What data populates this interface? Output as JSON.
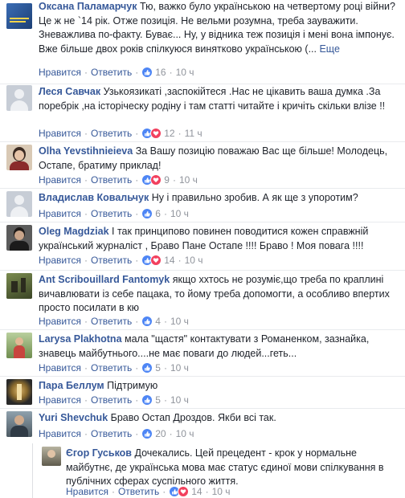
{
  "actions": {
    "like": "Нравится",
    "reply": "Ответить"
  },
  "comments": [
    {
      "name": "Оксана Паламарчук",
      "text": "Тю, важко було українською на четвертому році війни? Це ж не `14 рік. Отже позиція. Не вельми розумна, треба зауважити. Зневажлива по-факту. Буває... Ну, у відника теж позиція і мені вона імпонує. Вже більше двох років спілкуюся винятково українською (...",
      "more": "Еще",
      "reactions": [
        "like"
      ],
      "count": "16",
      "time": "10 ч"
    },
    {
      "name": "Леся Савчак",
      "text": "Узькоязикаті ,заспокійтеся .Нас не цікавить ваша думка .За поребрік ,на історіческу родіну і там статті читайте і кричіть скільки влізе !!",
      "reactions": [
        "like",
        "love"
      ],
      "count": "12",
      "time": "11 ч"
    },
    {
      "name": "Olha Yevstihnieieva",
      "text": "За Вашу позицію поважаю Вас ще більше! Молодець, Остапе, братиму приклад!",
      "reactions": [
        "like",
        "love"
      ],
      "count": "9",
      "time": "10 ч"
    },
    {
      "name": "Владислав Ковальчук",
      "text": "Ну і правильно зробив. А як ще з упоротим?",
      "reactions": [
        "like"
      ],
      "count": "6",
      "time": "10 ч"
    },
    {
      "name": "Oleg Magdziak",
      "text": "І так принципово повинен поводитися кожен справжній український журналіст , Браво Пане Остапе !!!! Браво ! Моя повага !!!!",
      "reactions": [
        "like",
        "love"
      ],
      "count": "14",
      "time": "10 ч"
    },
    {
      "name": "Ant Scribouillard Fantomyk",
      "text": "якщо ххтось не розуміє,що треба по краплині вичавлювати із себе пацака, то йому треба допомогти, а особливо впертих просто посилати в кю",
      "reactions": [
        "like"
      ],
      "count": "4",
      "time": "10 ч"
    },
    {
      "name": "Larysa Plakhotna",
      "text": "мала \"щастя\" контактувати з Романенком, зазнайка, знавець майбутнього....не має поваги до людей...геть...",
      "reactions": [
        "like"
      ],
      "count": "5",
      "time": "10 ч"
    },
    {
      "name": "Пара Беллум",
      "text": "Підтримую",
      "reactions": [
        "like"
      ],
      "count": "5",
      "time": "10 ч"
    },
    {
      "name": "Yuri Shevchuk",
      "text": "Браво Остап Дроздов. Якби всі так.",
      "reactions": [
        "like"
      ],
      "count": "20",
      "time": "10 ч"
    },
    {
      "name": "Єгор Гуськов",
      "text": "Дочекались. Цей прецедент - крок у нормальне майбутнє, де українська мова має статус єдиної мови спілкування в публічних сферах суспільного життя.",
      "reactions": [
        "like",
        "love"
      ],
      "count": "14",
      "time": "10 ч"
    }
  ],
  "colors": {
    "link": "#365899",
    "meta": "#90949c",
    "like": "#4e86f5",
    "love": "#f2405e"
  }
}
